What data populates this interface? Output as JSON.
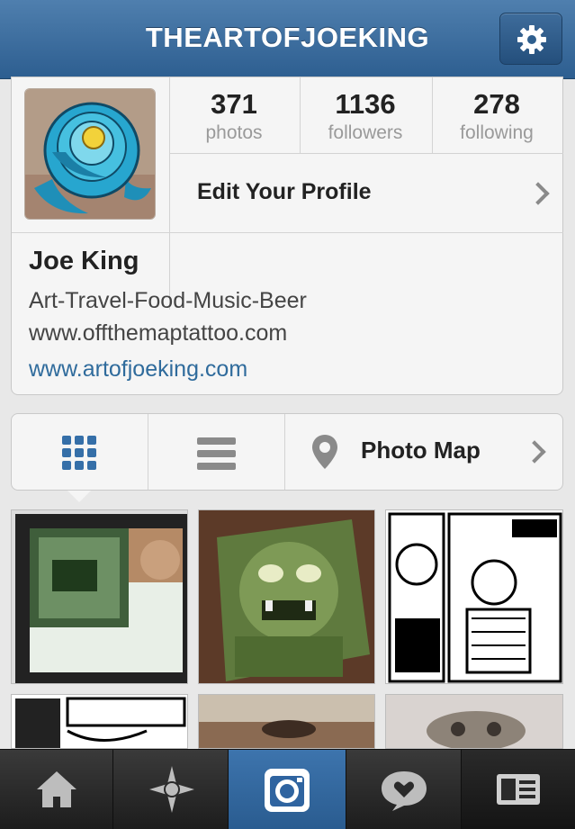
{
  "header": {
    "title": "THEARTOFJOEKING",
    "settings_icon": "gear-icon"
  },
  "profile": {
    "stats": [
      {
        "value": "371",
        "label": "photos"
      },
      {
        "value": "1136",
        "label": "followers"
      },
      {
        "value": "278",
        "label": "following"
      }
    ],
    "edit_label": "Edit Your Profile",
    "name": "Joe King",
    "bio_lines": [
      "Art-Travel-Food-Music-Beer",
      "www.offthemaptattoo.com"
    ],
    "website": "www.artofjoeking.com"
  },
  "view_tabs": {
    "grid_icon": "grid-icon",
    "list_icon": "list-icon",
    "photo_map_label": "Photo Map"
  },
  "photos": [
    {
      "name": "tattoo-monster-painting-framed"
    },
    {
      "name": "green-monster-painting"
    },
    {
      "name": "lucky-dog-drawing"
    },
    {
      "name": "lucky-dog-sketch"
    },
    {
      "name": "eye-painting"
    },
    {
      "name": "gray-creature-painting"
    }
  ],
  "tabbar": {
    "items": [
      "home-icon",
      "explore-icon",
      "camera-icon",
      "news-icon",
      "profile-icon"
    ],
    "active_color": "#3d74ad"
  },
  "colors": {
    "accent": "#2f6b9c",
    "header": "#3e6e9e"
  }
}
